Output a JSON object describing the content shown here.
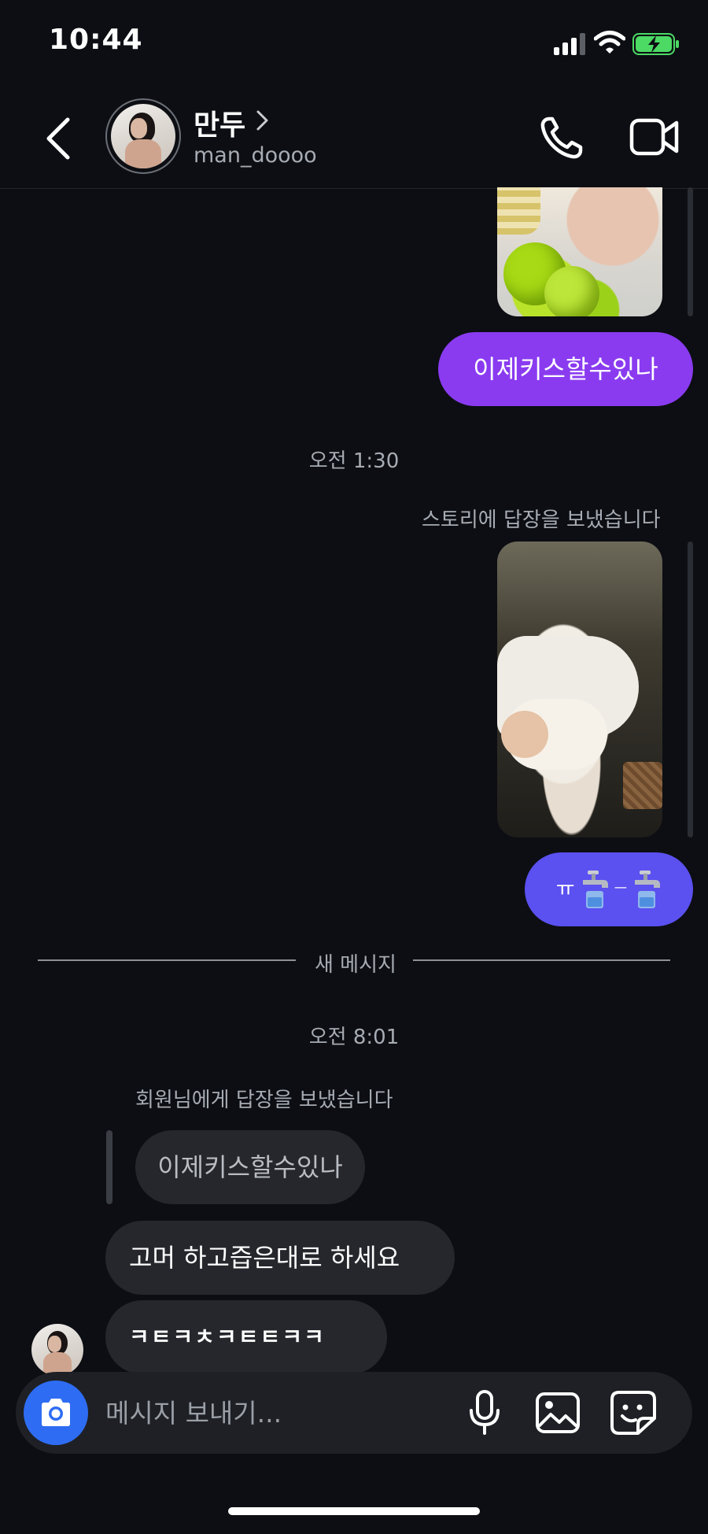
{
  "status_bar": {
    "time": "10:44"
  },
  "header": {
    "name": "만두",
    "handle": "man_doooo"
  },
  "messages": {
    "sent_text_1": "이제키스할수있나",
    "time_1": "오전 1:30",
    "story_reply_note": "스토리에 답장을 보냈습니다",
    "sent_text_2_prefix": "ㅠ",
    "sent_text_2_mid": "ㅡ",
    "divider_label": "새 메시지",
    "time_2": "오전 8:01",
    "reply_note": "회원님에게 답장을 보냈습니다",
    "quoted_text": "이제키스할수있나",
    "received_1": "고머 하고즙은대로 하세요",
    "received_2": "ㅋㅌㅋㅊㅋㅌㅌㅋㅋ"
  },
  "composer": {
    "placeholder": "메시지 보내기..."
  },
  "colors": {
    "background": "#0c0e13",
    "sent_bubble_purple": "#8a3bf0",
    "sent_bubble_indigo": "#5b50f0",
    "received_bubble": "#25272c",
    "camera_button": "#2e6df3",
    "battery_green": "#4cd964"
  },
  "icons": [
    "back-chevron-icon",
    "call-icon",
    "video-icon",
    "camera-icon",
    "mic-icon",
    "gallery-icon",
    "sticker-icon",
    "faucet-emoji-icon"
  ]
}
